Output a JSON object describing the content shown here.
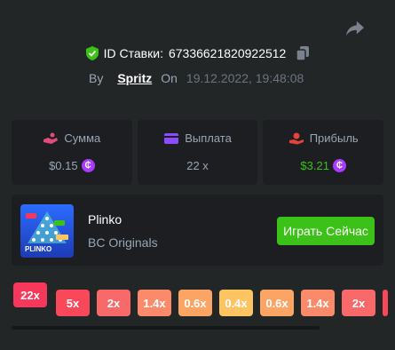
{
  "bet": {
    "id_label": "ID Ставки:",
    "id_value": "67336621820922512",
    "by_label": "By",
    "username": "Spritz",
    "on_label": "On",
    "datetime": "19.12.2022, 19:48:08"
  },
  "stats": [
    {
      "label": "Сумма",
      "value": "$0.15",
      "icon": "hand-coin-icon",
      "color": "#e44b7a",
      "has_coin": true,
      "value_color": "#98a7b5"
    },
    {
      "label": "Выплата",
      "value": "22 x",
      "icon": "wallet-icon",
      "color": "#8d4bff",
      "has_coin": false,
      "value_color": "#98a7b5"
    },
    {
      "label": "Прибыль",
      "value": "$3.21",
      "icon": "profit-hand-icon",
      "color": "#e5423a",
      "has_coin": true,
      "value_color": "#3bc117"
    }
  ],
  "coin_symbol": "₵",
  "game": {
    "name": "Plinko",
    "provider": "BC Originals",
    "play_label": "Играть Сейчас",
    "thumb_text": "PLINKO"
  },
  "multipliers": [
    {
      "label": "22x",
      "color": "#f8385a",
      "active": true
    },
    {
      "label": "5x",
      "color": "#f8485a"
    },
    {
      "label": "2x",
      "color": "#f8696a"
    },
    {
      "label": "1.4x",
      "color": "#fb8a6a"
    },
    {
      "label": "0.6x",
      "color": "#fca464"
    },
    {
      "label": "0.4x",
      "color": "#fdc461"
    },
    {
      "label": "0.6x",
      "color": "#fca464"
    },
    {
      "label": "1.4x",
      "color": "#fb8a6a"
    },
    {
      "label": "2x",
      "color": "#f8696a"
    }
  ],
  "colors": {
    "background": "#232626",
    "card": "#1c1e22",
    "accent_green": "#3bc117",
    "muted_text": "#98a7b5"
  }
}
